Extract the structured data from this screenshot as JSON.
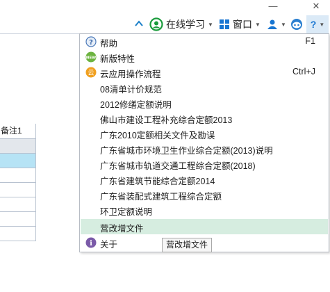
{
  "window": {
    "minimize_glyph": "—",
    "close_glyph": "✕"
  },
  "toolbar": {
    "online_learning": "在线学习",
    "window_label": "窗口"
  },
  "left_grid": {
    "header": "备注1"
  },
  "menu": {
    "items": [
      {
        "label": "帮助",
        "shortcut": "F1",
        "icon": "help-icon"
      },
      {
        "label": "新版特性",
        "shortcut": "",
        "icon": "new-badge-icon"
      },
      {
        "label": "云应用操作流程",
        "shortcut": "Ctrl+J",
        "icon": "cloud-app-icon"
      },
      {
        "label": "08清单计价规范",
        "shortcut": ""
      },
      {
        "label": "2012修缮定额说明",
        "shortcut": ""
      },
      {
        "label": "佛山市建设工程补充综合定额2013",
        "shortcut": ""
      },
      {
        "label": "广东2010定额相关文件及勘误",
        "shortcut": ""
      },
      {
        "label": "广东省城市环境卫生作业综合定额(2013)说明",
        "shortcut": ""
      },
      {
        "label": "广东省城市轨道交通工程综合定额(2018)",
        "shortcut": ""
      },
      {
        "label": "广东省建筑节能综合定额2014",
        "shortcut": ""
      },
      {
        "label": "广东省装配式建筑工程综合定额",
        "shortcut": ""
      },
      {
        "label": "环卫定额说明",
        "shortcut": ""
      },
      {
        "label": "营改增文件",
        "shortcut": ""
      },
      {
        "label": "关于",
        "shortcut": "",
        "icon": "about-icon"
      }
    ]
  },
  "tooltip": {
    "text": "营改增文件"
  },
  "colors": {
    "accent_green": "#1a9b3c",
    "highlight_row": "#d6ede0",
    "selected_grid_row": "#b6e3f5",
    "toolbar_blue": "#1976d2"
  }
}
